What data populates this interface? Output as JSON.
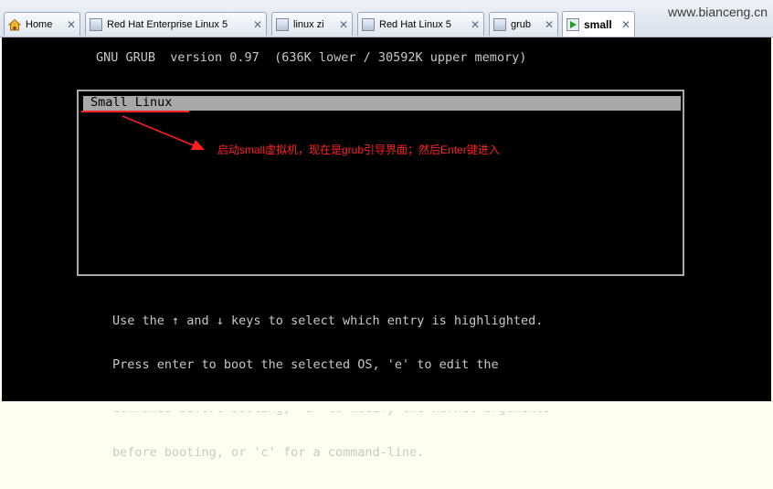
{
  "tabs": [
    {
      "label": "Home",
      "icon": "home-icon"
    },
    {
      "label": "Red Hat Enterprise Linux 5",
      "icon": "vm-icon"
    },
    {
      "label": "linux zi",
      "icon": "vm-icon"
    },
    {
      "label": "Red Hat Linux 5",
      "icon": "vm-icon"
    },
    {
      "label": "grub",
      "icon": "vm-icon"
    },
    {
      "label": "small",
      "icon": "play-icon",
      "active": true
    }
  ],
  "close_glyph": "✕",
  "brand": "www.bianceng.cn",
  "grub": {
    "header": "GNU GRUB  version 0.97  (636K lower / 30592K upper memory)",
    "entries": [
      "Small Linux"
    ],
    "help_lines": [
      "Use the ↑ and ↓ keys to select which entry is highlighted.",
      "Press enter to boot the selected OS, 'e' to edit the",
      "commands before booting, 'a' to modify the kernel arguments",
      "before booting, or 'c' for a command-line."
    ]
  },
  "annotation": "启动small虚拟机，现在是grub引导界面；然后Enter键进入",
  "colors": {
    "annotation": "#ff2020",
    "screen_bg": "#000000",
    "selection": "#a8a8a8"
  }
}
